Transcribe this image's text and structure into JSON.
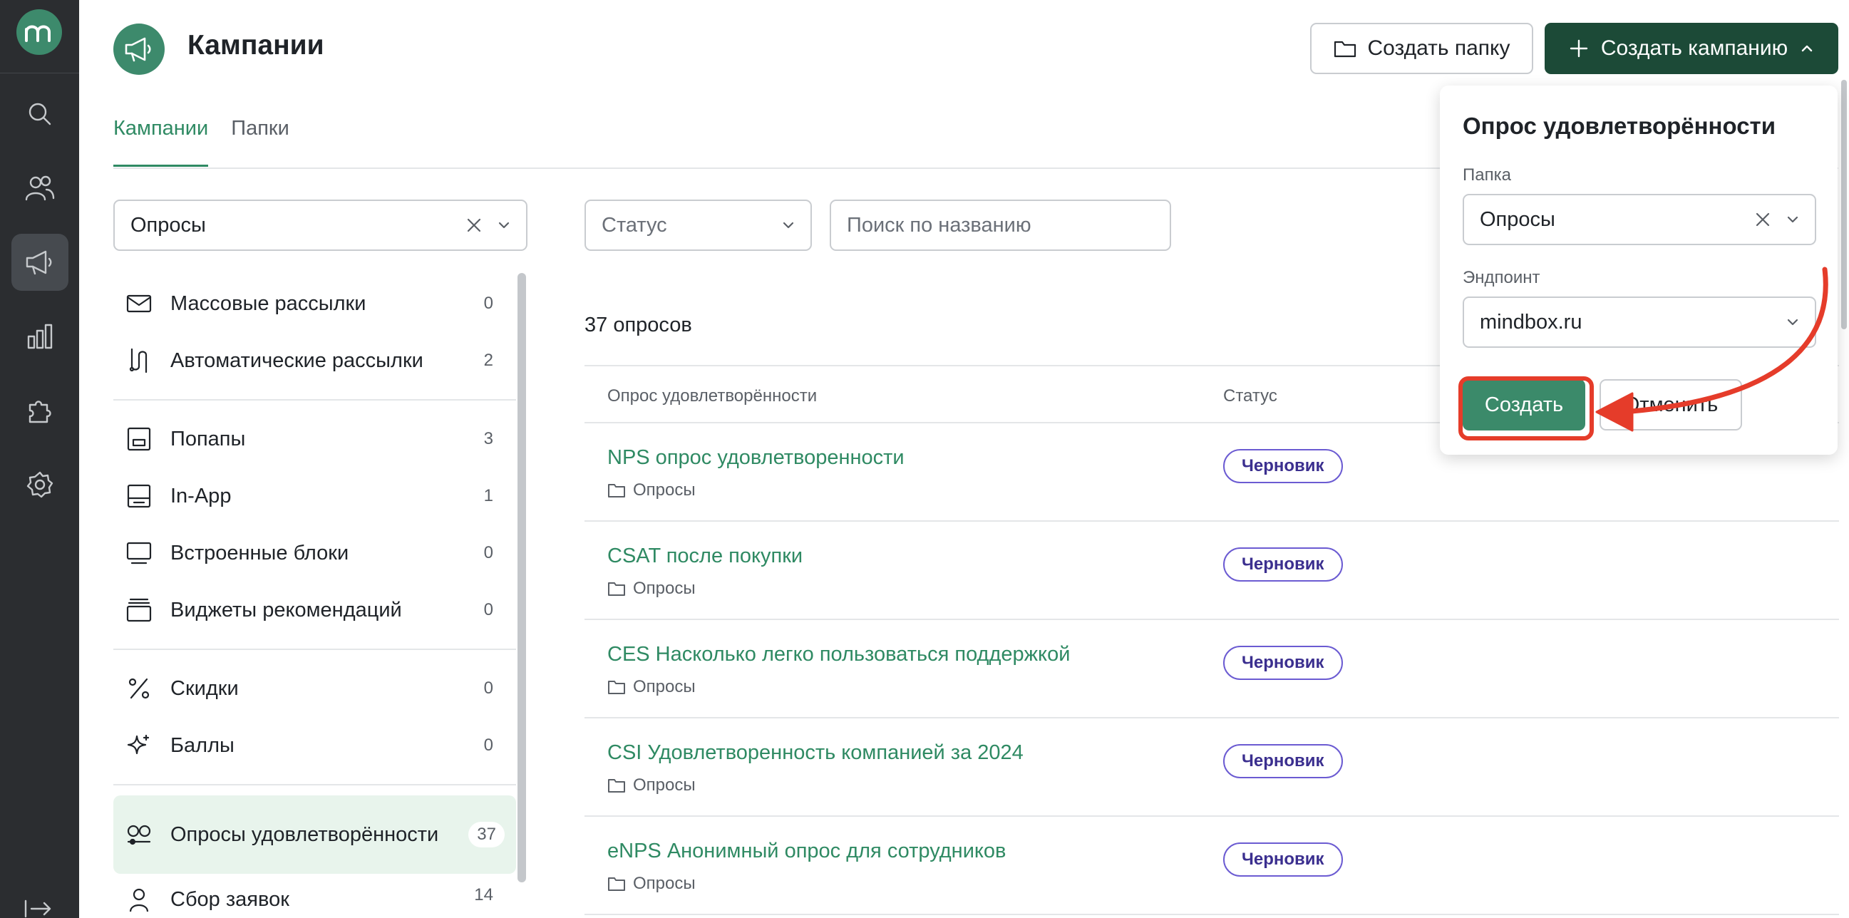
{
  "rail": {
    "items": [
      "search-icon",
      "users-icon",
      "campaigns-icon",
      "analytics-icon",
      "integrations-icon",
      "settings-icon"
    ]
  },
  "header": {
    "title": "Кампании",
    "create_folder_label": "Создать папку",
    "create_campaign_label": "Создать кампанию"
  },
  "tabs": [
    {
      "label": "Кампании",
      "active": true
    },
    {
      "label": "Папки",
      "active": false
    }
  ],
  "folder_filter": {
    "value": "Опросы"
  },
  "categories": [
    {
      "label": "Массовые рассылки",
      "count": "0",
      "icon": "mail-icon"
    },
    {
      "label": "Автоматические рассылки",
      "count": "2",
      "icon": "route-icon"
    },
    {
      "label": "Попапы",
      "count": "3",
      "icon": "popup-icon"
    },
    {
      "label": "In-App",
      "count": "1",
      "icon": "inapp-icon"
    },
    {
      "label": "Встроенные блоки",
      "count": "0",
      "icon": "monitor-icon"
    },
    {
      "label": "Виджеты рекомендаций",
      "count": "0",
      "icon": "widget-icon"
    },
    {
      "label": "Скидки",
      "count": "0",
      "icon": "percent-icon"
    },
    {
      "label": "Баллы",
      "count": "0",
      "icon": "sparkle-icon"
    },
    {
      "label": "Опросы удовлетворённости",
      "count": "37",
      "icon": "survey-icon",
      "active": true
    },
    {
      "label": "Сбор заявок",
      "count": "14",
      "icon": "person-icon"
    }
  ],
  "filters": {
    "status_placeholder": "Статус",
    "search_placeholder": "Поиск по названию"
  },
  "count_text": "37 опросов",
  "table": {
    "columns": [
      "Опрос удовлетворённости",
      "Статус"
    ],
    "rows": [
      {
        "name": "NPS опрос удовлетворенности",
        "folder": "Опросы",
        "status": "Черновик"
      },
      {
        "name": "CSAT после покупки",
        "folder": "Опросы",
        "status": "Черновик"
      },
      {
        "name": "CES Насколько легко пользоваться поддержкой",
        "folder": "Опросы",
        "status": "Черновик"
      },
      {
        "name": "CSI Удовлетворенность компанией за 2024",
        "folder": "Опросы",
        "status": "Черновик"
      },
      {
        "name": "eNPS Анонимный опрос для сотрудников",
        "folder": "Опросы",
        "status": "Черновик"
      }
    ]
  },
  "popover": {
    "title": "Опрос удовлетворённости",
    "folder_label": "Папка",
    "folder_value": "Опросы",
    "endpoint_label": "Эндпоинт",
    "endpoint_value": "mindbox.ru",
    "submit_label": "Создать",
    "cancel_label": "Отменить"
  },
  "colors": {
    "accent": "#2f8a63",
    "brand_dark": "#1c4a37",
    "rail_bg": "#2b2d30",
    "badge_border": "#6b5bd2",
    "highlight": "#e53c2a"
  }
}
